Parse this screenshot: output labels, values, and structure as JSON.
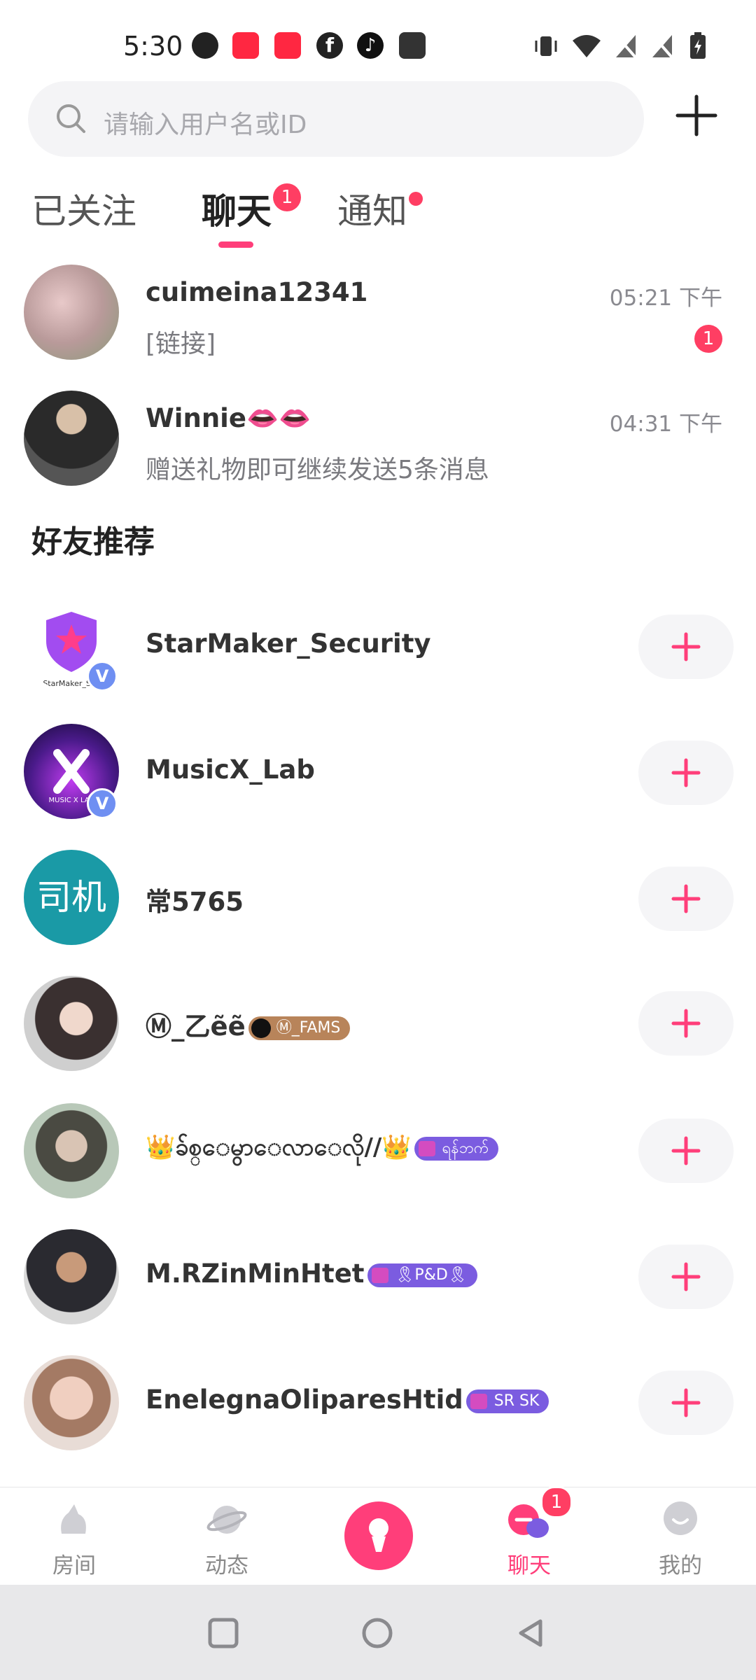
{
  "status_bar": {
    "time": "5:30",
    "left_icons": [
      "app-icon-p",
      "xiaohongshu-icon",
      "xiaohongshu-icon",
      "facebook-icon",
      "tiktok-icon",
      "wallet-icon"
    ],
    "right_icons": [
      "vibrate-icon",
      "wifi-icon",
      "no-sim-icon",
      "no-sim-icon",
      "battery-charging-icon"
    ]
  },
  "search": {
    "placeholder": "请输入用户名或ID"
  },
  "tabs": [
    {
      "label": "已关注"
    },
    {
      "label": "聊天",
      "badge": "1",
      "active": true
    },
    {
      "label": "通知",
      "dot": true
    }
  ],
  "chats": [
    {
      "name": "cuimeina12341",
      "preview": "[链接]",
      "time": "05:21 下午",
      "unread": "1"
    },
    {
      "name": "Winnie👄👄",
      "preview": "赠送礼物即可继续发送5条消息",
      "time": "04:31 下午"
    }
  ],
  "recommend": {
    "title": "好友推荐",
    "users": [
      {
        "name": "StarMaker_Security",
        "verified": true,
        "avatar_caption": "StarMaker_Sec"
      },
      {
        "name": "MusicX_Lab",
        "verified": true,
        "avatar_caption": "MUSIC X LAB"
      },
      {
        "name": "常5765",
        "avatar_text": "司机"
      },
      {
        "name": "Ⓜ_乙ẽẽ",
        "tag": "Ⓜ_FAMS"
      },
      {
        "name": "👑ခ်စ္ေမွာေလာေလို//👑",
        "tag": "ရန်ဘက်"
      },
      {
        "name": "M.RZinMinHtet",
        "tag": "🎗P&D🎗"
      },
      {
        "name": "EnelegnaOliparesHtid",
        "tag": "SR SK"
      }
    ]
  },
  "bottom_nav": {
    "items": [
      {
        "label": "房间"
      },
      {
        "label": "动态"
      },
      {
        "label": ""
      },
      {
        "label": "聊天",
        "badge": "1",
        "active": true
      },
      {
        "label": "我的"
      }
    ]
  },
  "colors": {
    "accent": "#ff3e7a",
    "badge": "#ff3e63",
    "verified": "#6f8ff2"
  }
}
